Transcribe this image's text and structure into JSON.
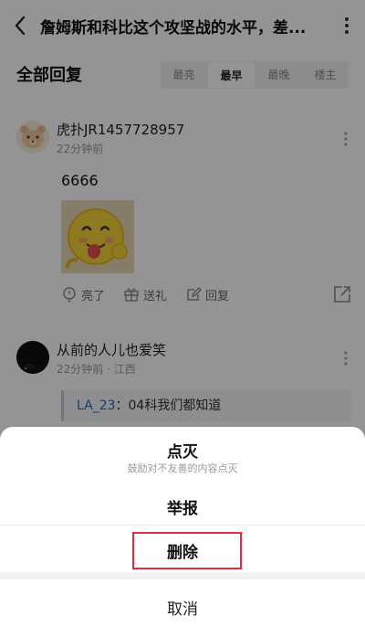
{
  "header": {
    "title": "詹姆斯和科比这个攻坚战的水平，差..."
  },
  "replies": {
    "title": "全部回复",
    "sort_tabs": [
      {
        "label": "最亮",
        "active": false
      },
      {
        "label": "最早",
        "active": true
      },
      {
        "label": "最晚",
        "active": false
      },
      {
        "label": "楼主",
        "active": false
      }
    ]
  },
  "comments": [
    {
      "user": "虎扑JR1457728957",
      "meta": "22分钟前",
      "text": "6666",
      "has_image": true,
      "actions": {
        "light": "亮了",
        "gift": "送礼",
        "reply": "回复"
      }
    },
    {
      "user": "从前的人儿也爱笑",
      "meta": "22分钟前 · 江西",
      "quote": {
        "name": "LA_23",
        "sep": "：",
        "text": "04科我们都知道"
      }
    }
  ],
  "sheet": {
    "dianmie": "点灭",
    "dianmie_sub": "鼓励对不友善的内容点灭",
    "report": "举报",
    "delete": "删除",
    "cancel": "取消"
  },
  "colors": {
    "highlight": "#d9303a",
    "quote_name": "#2b6cc4"
  }
}
